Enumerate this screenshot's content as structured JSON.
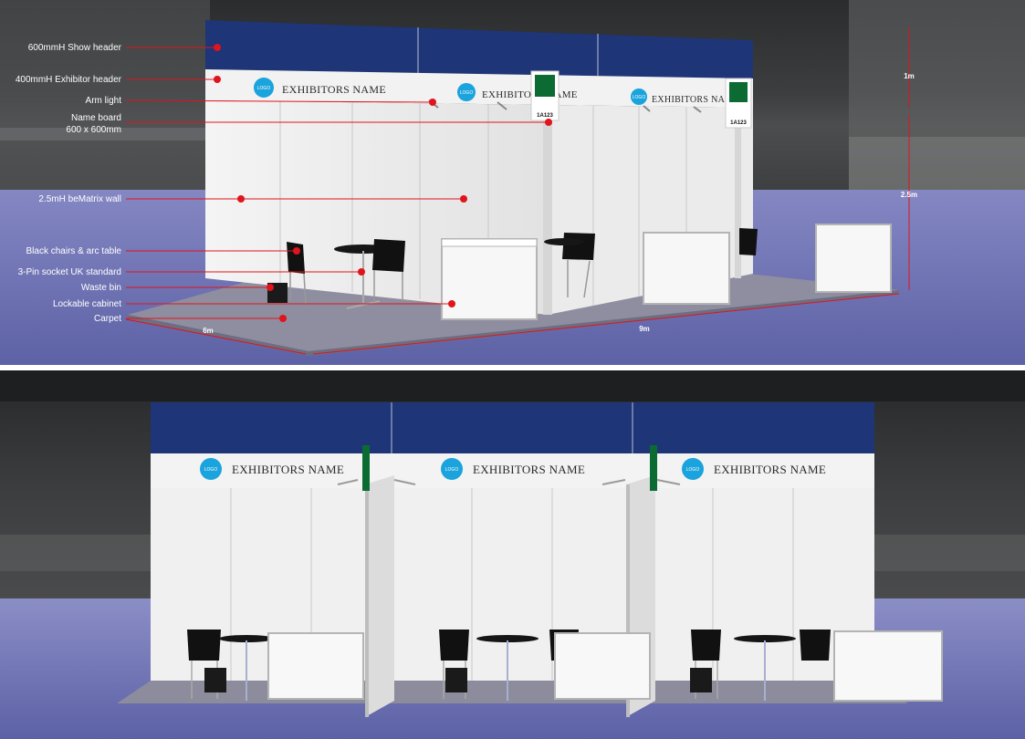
{
  "annotations": [
    {
      "label": "600mmH Show header"
    },
    {
      "label": "400mmH Exhibitor header"
    },
    {
      "label": "Arm light"
    },
    {
      "label": "Name board"
    },
    {
      "label": "600 x 600mm"
    },
    {
      "label": "2.5mH beMatrix wall"
    },
    {
      "label": "Black chairs & arc table"
    },
    {
      "label": "3-Pin socket UK standard"
    },
    {
      "label": "Waste bin"
    },
    {
      "label": "Lockable cabinet"
    },
    {
      "label": "Carpet"
    }
  ],
  "dimensions": {
    "width": "6m",
    "length": "9m",
    "header_height": "1m",
    "wall_height": "2.5m"
  },
  "booth": {
    "exhibitor_name": "EXHIBITORS NAME",
    "logo_text": "LOGO",
    "stand_number": "1A123"
  },
  "colors": {
    "header_blue": "#1e3577",
    "carpet": "#6a6fb0",
    "annotation_red": "#e0141c",
    "logo_blue": "#1aa3dc",
    "flag_green": "#0b6b33"
  }
}
